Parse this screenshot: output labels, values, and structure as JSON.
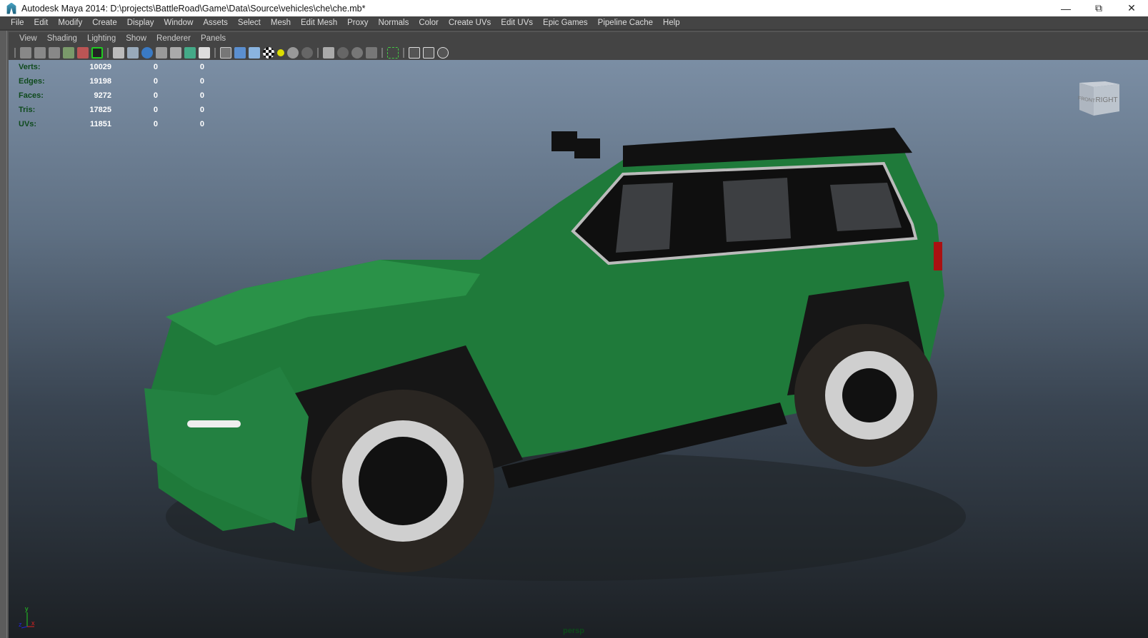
{
  "title": "Autodesk Maya 2014: D:\\projects\\BattleRoad\\Game\\Data\\Source\\vehicles\\che\\che.mb*",
  "window_buttons": [
    "minimize",
    "restore",
    "close"
  ],
  "menu": [
    "File",
    "Edit",
    "Modify",
    "Create",
    "Display",
    "Window",
    "Assets",
    "Select",
    "Mesh",
    "Edit Mesh",
    "Proxy",
    "Normals",
    "Color",
    "Create UVs",
    "Edit UVs",
    "Epic Games",
    "Pipeline Cache",
    "Help"
  ],
  "panel_menu": [
    "View",
    "Shading",
    "Lighting",
    "Show",
    "Renderer",
    "Panels"
  ],
  "hud": [
    {
      "label": "Verts:",
      "v": "10029",
      "a": "0",
      "b": "0"
    },
    {
      "label": "Edges:",
      "v": "19198",
      "a": "0",
      "b": "0"
    },
    {
      "label": "Faces:",
      "v": "9272",
      "a": "0",
      "b": "0"
    },
    {
      "label": "Tris:",
      "v": "17825",
      "a": "0",
      "b": "0"
    },
    {
      "label": "UVs:",
      "v": "11851",
      "a": "0",
      "b": "0"
    }
  ],
  "viewcube": {
    "front": "FRONT",
    "right": "RIGHT"
  },
  "axis": {
    "x": "x",
    "y": "y",
    "z": "z"
  },
  "camera": "persp",
  "colors": {
    "car_body": "#1f7a3a",
    "viewport_top": "#7b8ea4",
    "viewport_bottom": "#1c2024"
  }
}
